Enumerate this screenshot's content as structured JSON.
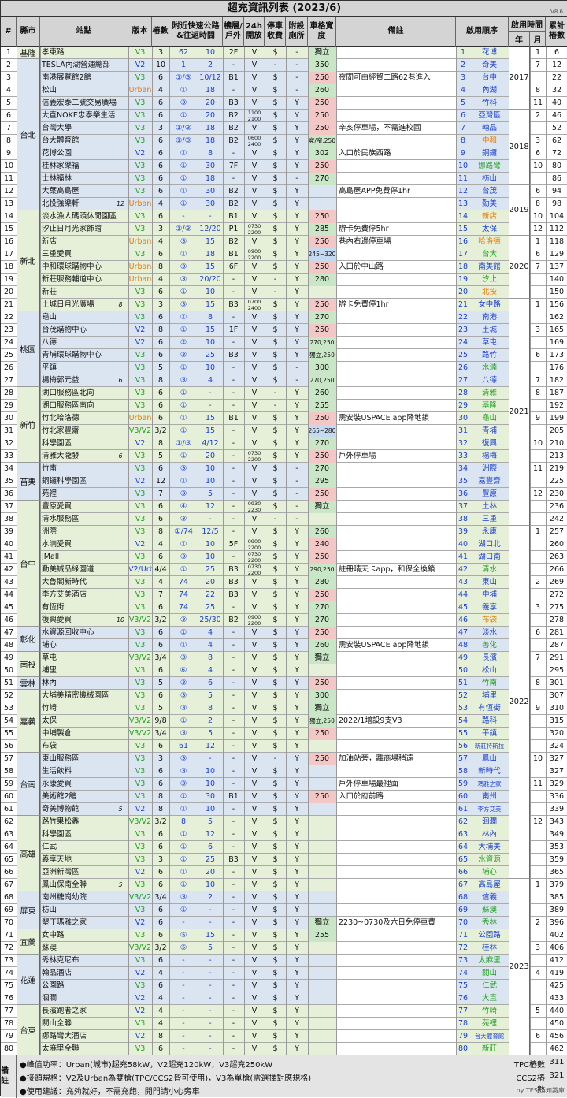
{
  "title": "超充資訊列表 (2023/6)",
  "version": "V8.6",
  "headers": {
    "idx": "#",
    "city": "縣市",
    "station": "站點",
    "version": "版本",
    "stalls": "樁數",
    "highway": "附近快速公路&往返時間",
    "floor": "樓層/戶外",
    "open24": "24h開放",
    "parking": "停車收費",
    "restroom": "附設廁所",
    "width": "車格寬度",
    "notes": "備註",
    "order": "啟用順序",
    "opentime": "啟用時間",
    "year": "年",
    "month": "月",
    "cum": "累計樁數"
  },
  "colors": {
    "header_bg": "#d4d4d4",
    "row_blue": "#dbe5f1",
    "row_green": "#e6f0d9",
    "badge_pink": "#f4c7c7",
    "badge_green": "#c9e7c7",
    "badge_blue": "#c5d9f1",
    "version_v3": "#21a021",
    "version_v2": "#1a3fd1",
    "version_urban": "#e87a00"
  },
  "rows": [
    [
      "1",
      "孝東路",
      "",
      "V3",
      "3",
      "62",
      "10",
      "2F",
      "V",
      "$",
      "-",
      "獨立",
      "",
      "1",
      "花博",
      "1",
      "6"
    ],
    [
      "2",
      "TESLA內湖營運總部",
      "",
      "V2",
      "10",
      "1",
      "2",
      "-",
      "V",
      "-",
      "-",
      "350",
      "",
      "2",
      "奇美",
      "7",
      "12"
    ],
    [
      "3",
      "南港展覽館2館",
      "",
      "V3",
      "6",
      "①/③",
      "10/12",
      "B1",
      "V",
      "$",
      "-",
      "250",
      "夜間可由經貿二路62巷進入",
      "3",
      "台中",
      "",
      "22"
    ],
    [
      "4",
      "松山",
      "",
      "Urban",
      "4",
      "①",
      "18",
      "-",
      "V",
      "$",
      "-",
      "260",
      "",
      "4",
      "內湖",
      "8",
      "32"
    ],
    [
      "5",
      "信義宏泰二號交易廣場",
      "",
      "V3",
      "6",
      "③",
      "20",
      "B3",
      "V",
      "$",
      "Y",
      "250",
      "",
      "5",
      "竹科",
      "11",
      "40"
    ],
    [
      "6",
      "大直NOKE忠泰樂生活",
      "",
      "V3",
      "6",
      "①",
      "20",
      "B2",
      "1100\n2100",
      "$",
      "Y",
      "250",
      "",
      "6",
      "亞灣區",
      "2",
      "46"
    ],
    [
      "7",
      "台灣大學",
      "",
      "V3",
      "3",
      "①/③",
      "18",
      "B2",
      "V",
      "$",
      "Y",
      "250",
      "辛亥停車場，不需進校園",
      "7",
      "翰品",
      "",
      "52"
    ],
    [
      "8",
      "台大體育館",
      "",
      "V3",
      "6",
      "①/③",
      "18",
      "B2",
      "0600\n2400",
      "$",
      "Y",
      "寬/窄,250",
      "",
      "8",
      "中和",
      "3",
      "62"
    ],
    [
      "9",
      "花博公園",
      "",
      "V2",
      "6",
      "①",
      "8",
      "-",
      "V",
      "$",
      "Y",
      "302",
      "入口於民族西路",
      "9",
      "銅鑼",
      "6",
      "72"
    ],
    [
      "10",
      "桂林家樂福",
      "",
      "V3",
      "6",
      "①",
      "30",
      "7F",
      "V",
      "$",
      "Y",
      "250",
      "",
      "10",
      "娜路彎",
      "10",
      "80"
    ],
    [
      "11",
      "士林福林",
      "",
      "V3",
      "6",
      "①",
      "18",
      "-",
      "V",
      "$",
      "-",
      "270",
      "",
      "11",
      "枋山",
      "",
      "86"
    ],
    [
      "12",
      "大葉高島屋",
      "",
      "V3",
      "6",
      "①",
      "30",
      "B2",
      "V",
      "$",
      "Y",
      "",
      "高島屋APP免費停1hr",
      "12",
      "台茂",
      "6",
      "94"
    ],
    [
      "13",
      "北投強樂軒",
      "12",
      "Urban",
      "4",
      "①",
      "30",
      "B2",
      "V",
      "$",
      "Y",
      "",
      "",
      "13",
      "勤美",
      "8",
      "98"
    ],
    [
      "14",
      "淡水漁人碼頭休閒園區",
      "",
      "V3",
      "6",
      "-",
      "-",
      "B1",
      "V",
      "$",
      "Y",
      "250",
      "",
      "14",
      "新店",
      "10",
      "104"
    ],
    [
      "15",
      "汐止日月光家飾館",
      "",
      "V3",
      "3",
      "①/③",
      "12/20",
      "P1",
      "0730\n2200",
      "$",
      "Y",
      "285",
      "辦卡免費停5hr",
      "15",
      "太保",
      "12",
      "112"
    ],
    [
      "16",
      "新店",
      "",
      "Urban",
      "4",
      "③",
      "15",
      "B2",
      "V",
      "$",
      "Y",
      "250",
      "巷內右邊停車場",
      "16",
      "哈洛德",
      "1",
      "118"
    ],
    [
      "17",
      "三重愛買",
      "",
      "V3",
      "6",
      "①",
      "18",
      "B1",
      "0900\n2200",
      "$",
      "Y",
      "245~320",
      "",
      "17",
      "台大",
      "6",
      "129"
    ],
    [
      "18",
      "中和環球購物中心",
      "",
      "Urban",
      "8",
      "③",
      "15",
      "6F",
      "V",
      "$",
      "Y",
      "250",
      "入口於中山路",
      "18",
      "南美館",
      "7",
      "137"
    ],
    [
      "19",
      "新莊服務輔道中心",
      "",
      "Urban",
      "4",
      "③",
      "20/20",
      "-",
      "V",
      "-",
      "Y",
      "280",
      "",
      "19",
      "汐止",
      "",
      "140"
    ],
    [
      "20",
      "新莊",
      "",
      "V3",
      "6",
      "①",
      "10",
      "-",
      "V",
      "-",
      "Y",
      "",
      "",
      "20",
      "北投",
      "",
      "150"
    ],
    [
      "21",
      "土城日月光廣場",
      "8",
      "V3",
      "3",
      "③",
      "15",
      "B3",
      "0700\n2400",
      "$",
      "Y",
      "250",
      "辦卡免費停1hr",
      "21",
      "女中路",
      "1",
      "156"
    ],
    [
      "22",
      "龜山",
      "",
      "V3",
      "6",
      "①",
      "8",
      "-",
      "V",
      "$",
      "Y",
      "270",
      "",
      "22",
      "南港",
      "",
      "162"
    ],
    [
      "23",
      "台茂購物中心",
      "",
      "V2",
      "8",
      "①",
      "15",
      "1F",
      "V",
      "$",
      "Y",
      "250",
      "",
      "23",
      "土城",
      "3",
      "165"
    ],
    [
      "24",
      "八德",
      "",
      "V2",
      "6",
      "②",
      "10",
      "-",
      "V",
      "$",
      "Y",
      "270,250",
      "",
      "24",
      "草屯",
      "",
      "169"
    ],
    [
      "25",
      "青埔環球購物中心",
      "",
      "V3",
      "6",
      "③",
      "25",
      "B3",
      "V",
      "$",
      "Y",
      "獨立,250",
      "",
      "25",
      "路竹",
      "6",
      "173"
    ],
    [
      "26",
      "平鎮",
      "",
      "V3",
      "5",
      "①",
      "10",
      "-",
      "V",
      "$",
      "-",
      "300",
      "",
      "26",
      "水湳",
      "",
      "176"
    ],
    [
      "27",
      "楊梅郭元益",
      "6",
      "V3",
      "8",
      "③",
      "4",
      "-",
      "V",
      "$",
      "-",
      "270,250",
      "",
      "27",
      "八德",
      "7",
      "182"
    ],
    [
      "28",
      "湖口服務區北向",
      "",
      "V3",
      "6",
      "①",
      "-",
      "-",
      "V",
      "-",
      "Y",
      "260",
      "",
      "28",
      "清雅",
      "8",
      "187"
    ],
    [
      "29",
      "湖口服務區南向",
      "",
      "V3",
      "6",
      "①",
      "-",
      "-",
      "V",
      "-",
      "Y",
      "255",
      "",
      "29",
      "基隆",
      "",
      "192"
    ],
    [
      "30",
      "竹北哈洛德",
      "",
      "Urban",
      "6",
      "①",
      "15",
      "B1",
      "V",
      "$",
      "Y",
      "250",
      "需安裝USPACE app降地鎖",
      "30",
      "龜山",
      "9",
      "199"
    ],
    [
      "31",
      "竹北家豐齋",
      "",
      "V3/V2",
      "3/2",
      "①",
      "15",
      "-",
      "V",
      "$",
      "Y",
      "265~280",
      "",
      "31",
      "青埔",
      "",
      "205"
    ],
    [
      "32",
      "科學園區",
      "",
      "V2",
      "8",
      "①/③",
      "4/12",
      "-",
      "V",
      "$",
      "Y",
      "270",
      "",
      "32",
      "復興",
      "10",
      "210"
    ],
    [
      "33",
      "清雅大瀧發",
      "6",
      "V3",
      "5",
      "①",
      "20",
      "-",
      "0730\n2200",
      "$",
      "Y",
      "250",
      "戶外停車場",
      "33",
      "楊梅",
      "",
      "213"
    ],
    [
      "34",
      "竹南",
      "",
      "V3",
      "6",
      "③",
      "10",
      "-",
      "V",
      "$",
      "-",
      "270",
      "",
      "34",
      "洲際",
      "11",
      "219"
    ],
    [
      "35",
      "銅鑼科學園區",
      "",
      "V2",
      "12",
      "①",
      "10",
      "-",
      "V",
      "$",
      "-",
      "295",
      "",
      "35",
      "嘉豐齋",
      "",
      "225"
    ],
    [
      "36",
      "苑裡",
      "",
      "V3",
      "7",
      "③",
      "5",
      "-",
      "V",
      "$",
      "-",
      "250",
      "",
      "36",
      "豐原",
      "12",
      "230"
    ],
    [
      "37",
      "豐原愛買",
      "",
      "V3",
      "6",
      "④",
      "12",
      "-",
      "0930\n2230",
      "$",
      "-",
      "獨立",
      "",
      "37",
      "土林",
      "",
      "236"
    ],
    [
      "38",
      "清水服務區",
      "",
      "V3",
      "6",
      "③",
      "-",
      "-",
      "V",
      "-",
      "-",
      "",
      "",
      "38",
      "三重",
      "",
      "242"
    ],
    [
      "39",
      "洲際",
      "",
      "V3",
      "8",
      "①/74",
      "12/5",
      "-",
      "V",
      "$",
      "Y",
      "260",
      "",
      "39",
      "永康",
      "1",
      "257"
    ],
    [
      "40",
      "水湳愛買",
      "",
      "V2",
      "4",
      "①",
      "10",
      "5F",
      "0900\n2200",
      "$",
      "Y",
      "240",
      "",
      "40",
      "湖口北",
      "",
      "260"
    ],
    [
      "41",
      "JMall",
      "",
      "V3",
      "6",
      "③",
      "10",
      "-",
      "0730\n2200",
      "$",
      "Y",
      "250",
      "",
      "41",
      "湖口南",
      "",
      "263"
    ],
    [
      "42",
      "勤美誠品綠園道",
      "",
      "V2/Urb",
      "4/4",
      "①",
      "25",
      "B3",
      "0730\n2200",
      "$",
      "Y",
      "290,250",
      "註冊晴天卡app，和保全換鎖",
      "42",
      "清水",
      "",
      "266"
    ],
    [
      "43",
      "大魯閣新時代",
      "",
      "V3",
      "4",
      "74",
      "20",
      "B3",
      "V",
      "$",
      "Y",
      "280",
      "",
      "43",
      "東山",
      "2",
      "269"
    ],
    [
      "44",
      "李方艾美酒店",
      "",
      "V3",
      "7",
      "74",
      "22",
      "B3",
      "V",
      "$",
      "Y",
      "250",
      "",
      "44",
      "中埔",
      "",
      "272"
    ],
    [
      "45",
      "有恆街",
      "",
      "V3",
      "6",
      "74",
      "25",
      "-",
      "V",
      "$",
      "Y",
      "270",
      "",
      "45",
      "義享",
      "3",
      "275"
    ],
    [
      "46",
      "復興愛買",
      "10",
      "V3/V2",
      "3/2",
      "③",
      "25/30",
      "B2",
      "0900\n2200",
      "$",
      "Y",
      "270",
      "",
      "46",
      "布袋",
      "",
      "278"
    ],
    [
      "47",
      "水資源回收中心",
      "",
      "V3",
      "6",
      "①",
      "4",
      "-",
      "V",
      "$",
      "Y",
      "250",
      "",
      "47",
      "淡水",
      "6",
      "281"
    ],
    [
      "48",
      "埔心",
      "",
      "V3",
      "6",
      "①",
      "4",
      "-",
      "V",
      "$",
      "Y",
      "260",
      "需安裝USPACE app降地鎖",
      "48",
      "善化",
      "",
      "287"
    ],
    [
      "49",
      "草屯",
      "",
      "V3/V2",
      "3/4",
      "③",
      "8",
      "-",
      "V",
      "$",
      "Y",
      "獨立",
      "",
      "49",
      "長濱",
      "7",
      "291"
    ],
    [
      "50",
      "埔里",
      "",
      "V3",
      "6",
      "⑥",
      "4",
      "-",
      "V",
      "$",
      "Y",
      "",
      "",
      "50",
      "松山",
      "",
      "295"
    ],
    [
      "51",
      "林內",
      "",
      "V3",
      "5",
      "③",
      "6",
      "-",
      "V",
      "$",
      "Y",
      "250",
      "",
      "51",
      "竹南",
      "8",
      "301"
    ],
    [
      "52",
      "大埔美精密機械園區",
      "",
      "V3",
      "6",
      "③",
      "5",
      "-",
      "V",
      "$",
      "Y",
      "300",
      "",
      "52",
      "埔里",
      "",
      "307"
    ],
    [
      "53",
      "竹崎",
      "",
      "V3",
      "5",
      "③",
      "8",
      "-",
      "V",
      "$",
      "Y",
      "獨立",
      "",
      "53",
      "有恆街",
      "9",
      "310"
    ],
    [
      "54",
      "太保",
      "",
      "V3/V2",
      "9/8",
      "①",
      "2",
      "-",
      "V",
      "$",
      "Y",
      "獨立,250",
      "2022/1增設9支V3",
      "54",
      "路科",
      "",
      "315"
    ],
    [
      "55",
      "中埔製倉",
      "",
      "V3/V2",
      "3/4",
      "③",
      "5",
      "-",
      "V",
      "$",
      "Y",
      "250",
      "",
      "55",
      "平鎮",
      "",
      "320"
    ],
    [
      "56",
      "布袋",
      "",
      "V3",
      "6",
      "61",
      "12",
      "-",
      "V",
      "$",
      "Y",
      "",
      "",
      "56",
      "新莊特斯拉",
      "",
      "324"
    ],
    [
      "57",
      "東山服務區",
      "",
      "V3",
      "3",
      "③",
      "-",
      "-",
      "V",
      "-",
      "Y",
      "250",
      "加油站旁，離商場稍遠",
      "57",
      "鳳山",
      "10",
      "327"
    ],
    [
      "58",
      "生活飲料",
      "",
      "V3",
      "6",
      "③",
      "10",
      "-",
      "V",
      "$",
      "Y",
      "",
      "",
      "58",
      "新時代",
      "",
      "327"
    ],
    [
      "59",
      "永康愛買",
      "",
      "V3",
      "6",
      "③",
      "10",
      "-",
      "V",
      "$",
      "Y",
      "",
      "戶外停車場最裡面",
      "59",
      "瑪雅之家",
      "11",
      "329"
    ],
    [
      "60",
      "美術館2館",
      "",
      "V3",
      "8",
      "①",
      "30",
      "B1",
      "V",
      "$",
      "Y",
      "250",
      "入口於府前路",
      "60",
      "南州",
      "",
      "336"
    ],
    [
      "61",
      "奇美博物館",
      "5",
      "V2",
      "8",
      "①",
      "10",
      "-",
      "V",
      "$",
      "Y",
      "",
      "",
      "61",
      "李方艾美",
      "",
      "339"
    ],
    [
      "62",
      "路竹果松鑫",
      "",
      "V3/V2",
      "3/2",
      "8",
      "5",
      "-",
      "V",
      "$",
      "Y",
      "",
      "",
      "62",
      "洄瀾",
      "12",
      "343"
    ],
    [
      "63",
      "科學園區",
      "",
      "V3",
      "6",
      "①",
      "12",
      "-",
      "V",
      "$",
      "Y",
      "",
      "",
      "63",
      "林內",
      "",
      "349"
    ],
    [
      "64",
      "仁武",
      "",
      "V3",
      "6",
      "①",
      "6",
      "-",
      "V",
      "$",
      "Y",
      "",
      "",
      "64",
      "大埔美",
      "",
      "353"
    ],
    [
      "65",
      "義享天地",
      "",
      "V3",
      "3",
      "①",
      "25",
      "B3",
      "V",
      "$",
      "Y",
      "",
      "",
      "65",
      "水資源",
      "",
      "359"
    ],
    [
      "66",
      "亞洲新灣區",
      "",
      "V2",
      "6",
      "①",
      "20",
      "-",
      "V",
      "$",
      "Y",
      "",
      "",
      "66",
      "埔心",
      "",
      "365"
    ],
    [
      "67",
      "鳳山保南全聯",
      "5",
      "V3",
      "6",
      "①",
      "10",
      "-",
      "V",
      "$",
      "Y",
      "",
      "",
      "67",
      "高島屋",
      "1",
      "379"
    ],
    [
      "68",
      "南州糖崗幼院",
      "",
      "V3/V2",
      "3/4",
      "③",
      "2",
      "-",
      "V",
      "$",
      "Y",
      "",
      "",
      "68",
      "信義",
      "",
      "385"
    ],
    [
      "69",
      "枋山",
      "",
      "V3",
      "6",
      "①",
      "-",
      "-",
      "V",
      "$",
      "Y",
      "",
      "",
      "69",
      "蘇澳",
      "",
      "389"
    ],
    [
      "70",
      "墾丁瑪雅之家",
      "",
      "V2",
      "6",
      "-",
      "-",
      "-",
      "V",
      "$",
      "Y",
      "獨立",
      "2230~0730及六日免停車費",
      "70",
      "秀林",
      "2",
      "396"
    ],
    [
      "71",
      "女中路",
      "",
      "V3",
      "6",
      "⑤",
      "15",
      "-",
      "V",
      "$",
      "Y",
      "255",
      "",
      "71",
      "公園路",
      "",
      "402"
    ],
    [
      "72",
      "蘇澳",
      "",
      "V3/V2",
      "3/2",
      "⑤",
      "5",
      "-",
      "V",
      "$",
      "Y",
      "",
      "",
      "72",
      "桂林",
      "3",
      "406"
    ],
    [
      "73",
      "秀林克尼布",
      "",
      "V3",
      "6",
      "-",
      "-",
      "-",
      "V",
      "$",
      "Y",
      "",
      "",
      "73",
      "太麻里",
      "",
      "412"
    ],
    [
      "74",
      "翰品酒店",
      "",
      "V2",
      "4",
      "-",
      "-",
      "-",
      "V",
      "$",
      "Y",
      "",
      "",
      "74",
      "關山",
      "4",
      "419"
    ],
    [
      "75",
      "公園路",
      "",
      "V3",
      "6",
      "-",
      "-",
      "-",
      "V",
      "$",
      "Y",
      "",
      "",
      "75",
      "仁武",
      "",
      "425"
    ],
    [
      "76",
      "洄瀾",
      "",
      "V2",
      "4",
      "-",
      "-",
      "-",
      "V",
      "$",
      "Y",
      "",
      "",
      "76",
      "大直",
      "",
      "433"
    ],
    [
      "77",
      "長濱跑者之家",
      "",
      "V2",
      "4",
      "-",
      "-",
      "-",
      "V",
      "$",
      "Y",
      "",
      "",
      "77",
      "竹崎",
      "5",
      "440"
    ],
    [
      "78",
      "關山全聯",
      "",
      "V3",
      "4",
      "-",
      "-",
      "-",
      "V",
      "$",
      "Y",
      "",
      "",
      "78",
      "苑裡",
      "",
      "450"
    ],
    [
      "79",
      "娜路彎大酒店",
      "",
      "V2",
      "8",
      "-",
      "-",
      "-",
      "V",
      "$",
      "Y",
      "",
      "",
      "79",
      "台大體育館",
      "6",
      "456"
    ],
    [
      "80",
      "太麻里全聯",
      "",
      "V3",
      "6",
      "-",
      "-",
      "-",
      "V",
      "$",
      "Y",
      "",
      "",
      "80",
      "新莊",
      "",
      "462"
    ]
  ],
  "cities": [
    [
      "基隆",
      1,
      1
    ],
    [
      "台北",
      2,
      13
    ],
    [
      "新北",
      14,
      21
    ],
    [
      "桃園",
      22,
      27
    ],
    [
      "新竹",
      28,
      33
    ],
    [
      "苗栗",
      34,
      36
    ],
    [
      "台中",
      37,
      46
    ],
    [
      "彰化",
      47,
      48
    ],
    [
      "南投",
      49,
      50
    ],
    [
      "雲林",
      51,
      51
    ],
    [
      "嘉義",
      52,
      56
    ],
    [
      "台南",
      57,
      61
    ],
    [
      "高雄",
      62,
      67
    ],
    [
      "屏東",
      68,
      70
    ],
    [
      "宜蘭",
      71,
      72
    ],
    [
      "花蓮",
      73,
      76
    ],
    [
      "台東",
      77,
      80
    ]
  ],
  "years": [
    [
      "2017",
      1,
      5
    ],
    [
      "2018",
      6,
      11
    ],
    [
      "2019",
      12,
      15
    ],
    [
      "2020",
      16,
      20
    ],
    [
      "2021",
      21,
      38
    ],
    [
      "2022",
      39,
      66
    ],
    [
      "2023",
      67,
      80
    ]
  ],
  "footer": {
    "label": "備註",
    "notes": [
      "●峰值功率：Urban(城市)超充58kW，V2超充120kW，V3超充250kW",
      "●接頭規格：V2及Urban為雙槍(TPC/CCS2皆可使用)，V3為單槍(需選擇對應規格)",
      "●使用建議：充夠就好，不需充飽，開門請小心旁車"
    ],
    "tpc_label": "TPC樁數",
    "tpc_count": "311",
    "ccs2_label": "CCS2樁數",
    "ccs2_count": "321",
    "credit": "by TESLA知識庫"
  }
}
